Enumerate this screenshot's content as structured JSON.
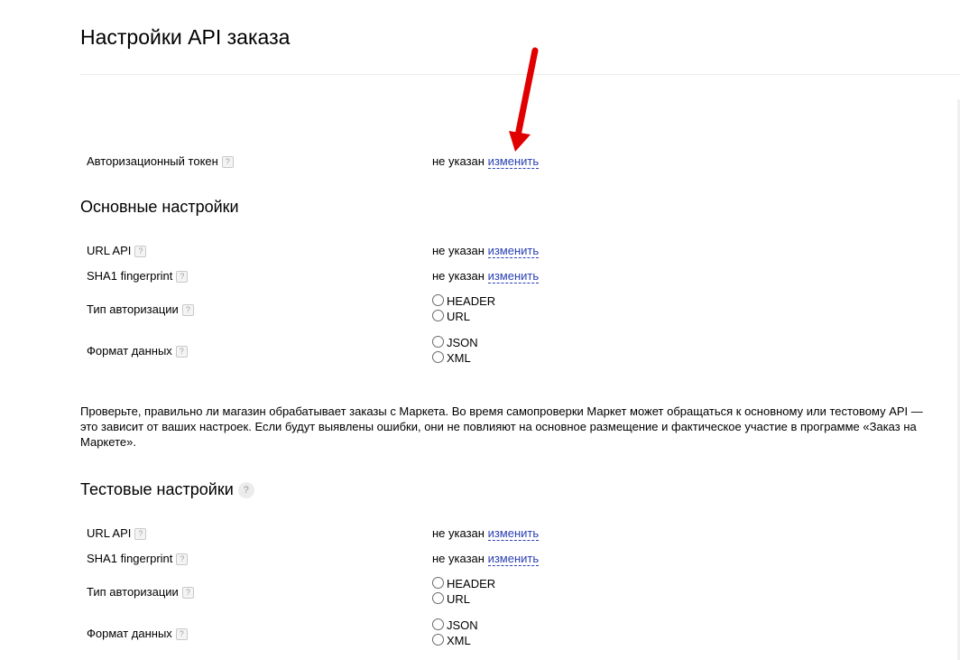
{
  "page": {
    "title": "Настройки API заказа"
  },
  "auth_token": {
    "label": "Авторизационный токен",
    "value": "не указан",
    "action": "изменить"
  },
  "main": {
    "title": "Основные настройки",
    "url_api": {
      "label": "URL API",
      "value": "не указан",
      "action": "изменить"
    },
    "sha1": {
      "label": "SHA1 fingerprint",
      "value": "не указан",
      "action": "изменить"
    },
    "auth_type": {
      "label": "Тип авторизации",
      "options": [
        "HEADER",
        "URL"
      ]
    },
    "data_format": {
      "label": "Формат данных",
      "options": [
        "JSON",
        "XML"
      ]
    }
  },
  "note": "Проверьте, правильно ли магазин обрабатывает заказы с Маркета. Во время самопроверки Маркет может обращаться к основному или тестовому API — это зависит от ваших настроек. Если будут выявлены ошибки, они не повлияют на основное размещение и фактическое участие в программе «Заказ на Маркете».",
  "test": {
    "title": "Тестовые настройки",
    "url_api": {
      "label": "URL API",
      "value": "не указан",
      "action": "изменить"
    },
    "sha1": {
      "label": "SHA1 fingerprint",
      "value": "не указан",
      "action": "изменить"
    },
    "auth_type": {
      "label": "Тип авторизации",
      "options": [
        "HEADER",
        "URL"
      ]
    },
    "data_format": {
      "label": "Формат данных",
      "options": [
        "JSON",
        "XML"
      ]
    }
  },
  "help_glyph": "?",
  "colors": {
    "link": "#2a3fb5",
    "arrow": "#e00000"
  }
}
